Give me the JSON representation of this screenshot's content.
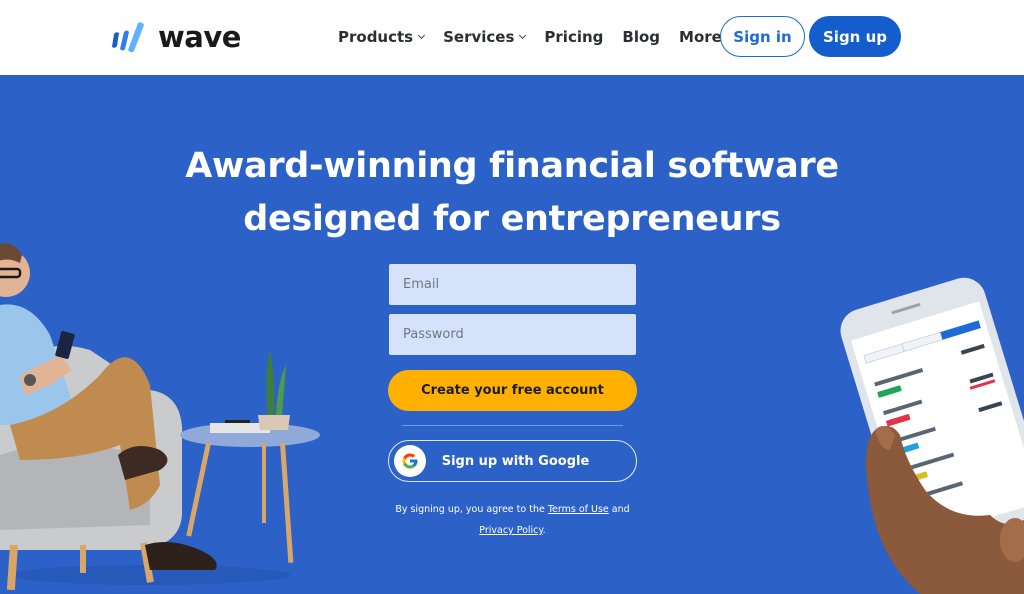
{
  "header": {
    "logo_text": "wave",
    "nav": [
      {
        "label": "Products",
        "has_dropdown": true
      },
      {
        "label": "Services",
        "has_dropdown": true
      },
      {
        "label": "Pricing",
        "has_dropdown": false
      },
      {
        "label": "Blog",
        "has_dropdown": false
      },
      {
        "label": "More",
        "has_dropdown": true
      }
    ],
    "sign_in_label": "Sign in",
    "sign_up_label": "Sign up"
  },
  "hero": {
    "title_line1": "Award-winning financial software",
    "title_line2": "designed for entrepreneurs",
    "form": {
      "email_placeholder": "Email",
      "email_value": "",
      "password_placeholder": "Password",
      "password_value": "",
      "create_account_label": "Create your free account",
      "google_label": "Sign up with Google"
    },
    "legal": {
      "prefix": "By signing up, you agree to the ",
      "terms_link": "Terms of Use",
      "middle": " and",
      "privacy_link": "Privacy Policy",
      "suffix": "."
    }
  },
  "illustrations": {
    "left": "man-sitting-in-armchair-with-phone",
    "right": "hand-holding-phone-with-wave-app"
  },
  "colors": {
    "hero_background": "#2c62c8",
    "header_background": "#ffffff",
    "primary_blue": "#135dcd",
    "cta_yellow": "#ffb000",
    "field_background": "#d6e2fa"
  }
}
